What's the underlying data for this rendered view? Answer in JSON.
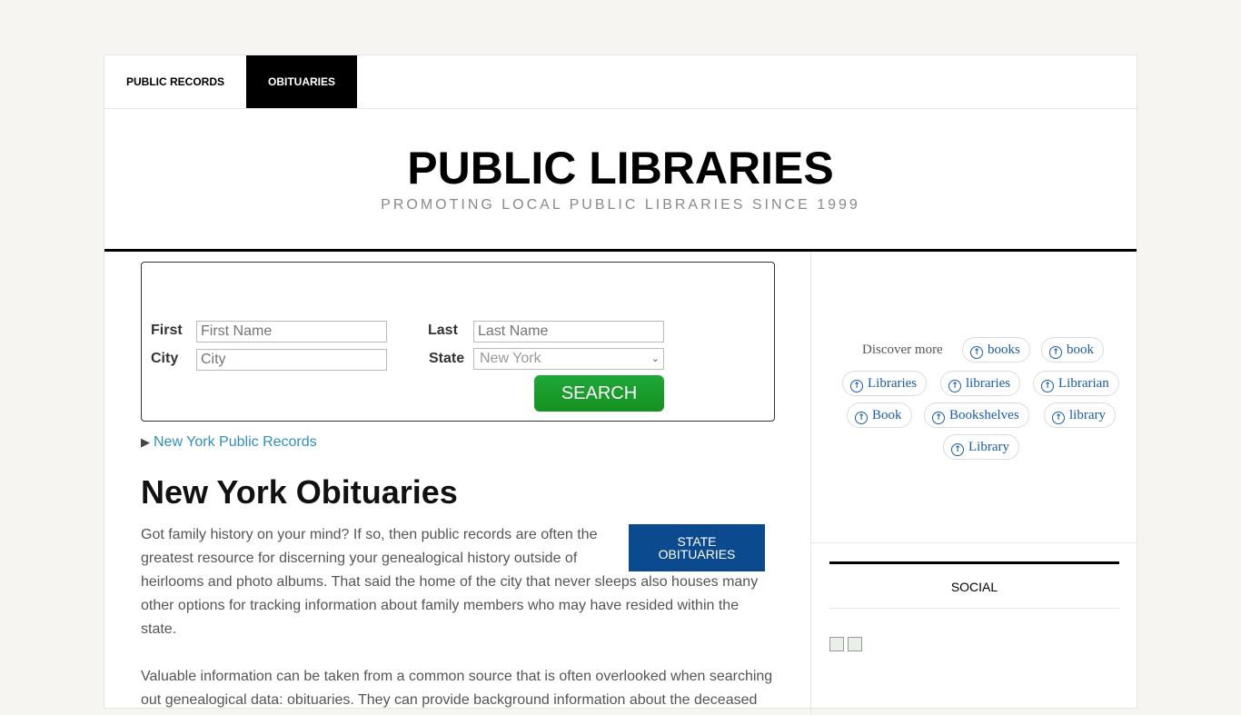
{
  "nav": {
    "public_records": "PUBLIC RECORDS",
    "obituaries": "OBITUARIES"
  },
  "header": {
    "title": "PUBLIC LIBRARIES",
    "tagline": "PROMOTING LOCAL PUBLIC LIBRARIES SINCE 1999"
  },
  "search": {
    "first_label": "First",
    "first_placeholder": "First Name",
    "last_label": "Last",
    "last_placeholder": "Last Name",
    "city_label": "City",
    "city_placeholder": "City",
    "state_label": "State",
    "state_value": "New York",
    "button": "SEARCH"
  },
  "links": {
    "ny_records": "New York Public Records"
  },
  "main": {
    "heading": "New York Obituaries",
    "state_button_line1": "STATE",
    "state_button_line2": "OBITUARIES",
    "p1": "Got family history on your mind? If so, then public records are often the greatest resource for discerning your genealogical history outside of",
    "p1b": "heirlooms and photo albums. That said the home of the city that never sleeps also houses many other options for tracking information about family members who may have resided within the state.",
    "p2": "Valuable information can be taken from a common source that is often overlooked when searching out genealogical data: obituaries. They can provide background information about the deceased"
  },
  "sidebar": {
    "discover": "Discover more",
    "chips": [
      "books",
      "book",
      "Libraries",
      "libraries",
      "Librarian",
      "Book",
      "Bookshelves",
      "library",
      "Library"
    ],
    "social": "SOCIAL"
  }
}
